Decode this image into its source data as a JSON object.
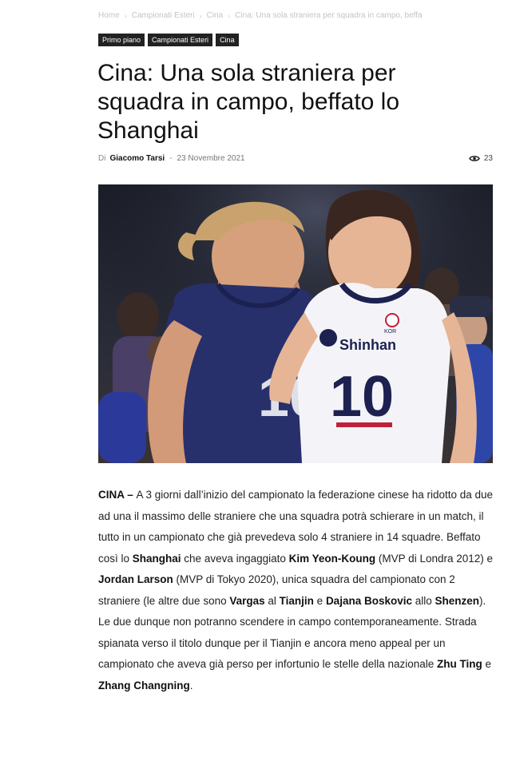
{
  "breadcrumb": {
    "items": [
      "Home",
      "Campionati Esteri",
      "Cina",
      "Cina: Una sola straniera per squadra in campo, beffa"
    ]
  },
  "tags": [
    "Primo piano",
    "Campionati Esteri",
    "Cina"
  ],
  "article": {
    "title": "Cina: Una sola straniera per squadra in campo, beffato lo Shanghai",
    "by_label": "Di",
    "author": "Giacomo Tarsi",
    "separator": "-",
    "date": "23 Novembre 2021",
    "views": "23"
  },
  "hero": {
    "jersey_left_number": "10",
    "jersey_right_number": "10",
    "jersey_right_sponsor": "Shinhan",
    "jersey_right_badge": "KOR"
  },
  "body": [
    {
      "t": "CINA – ",
      "b": true
    },
    {
      "t": "A 3 giorni dall’inizio del campionato la federazione cinese ha ridotto da due ad una il massimo delle straniere che una squadra potrà schierare in un match, il tutto in un campionato che già prevedeva solo 4 straniere in 14 squadre. Beffato così lo ",
      "b": false
    },
    {
      "t": "Shanghai",
      "b": true
    },
    {
      "t": " che aveva ingaggiato ",
      "b": false
    },
    {
      "t": "Kim Yeon-Koung",
      "b": true
    },
    {
      "t": " (MVP di Londra 2012) e ",
      "b": false
    },
    {
      "t": "Jordan Larson",
      "b": true
    },
    {
      "t": " (MVP di Tokyo 2020), unica squadra del campionato con 2 straniere (le altre due sono ",
      "b": false
    },
    {
      "t": "Vargas",
      "b": true
    },
    {
      "t": " al ",
      "b": false
    },
    {
      "t": "Tianjin",
      "b": true
    },
    {
      "t": " e ",
      "b": false
    },
    {
      "t": "Dajana Boskovic",
      "b": true
    },
    {
      "t": " allo ",
      "b": false
    },
    {
      "t": "Shenzen",
      "b": true
    },
    {
      "t": "). Le due dunque non potranno scendere in campo contemporaneamente. Strada spianata verso il titolo dunque per il Tianjin e ancora meno appeal per un campionato che aveva già perso per infortunio le stelle della nazionale ",
      "b": false
    },
    {
      "t": "Zhu Ting",
      "b": true
    },
    {
      "t": " e ",
      "b": false
    },
    {
      "t": "Zhang Changning",
      "b": true
    },
    {
      "t": ".",
      "b": false
    }
  ],
  "colors": {
    "tag_bg": "#222222",
    "breadcrumb": "#c4c4c4",
    "usa_jersey": "#27306b",
    "korea_jersey": "#f4f4f8",
    "korea_number": "#1d2150"
  },
  "icons": {
    "views": "eye-icon"
  }
}
